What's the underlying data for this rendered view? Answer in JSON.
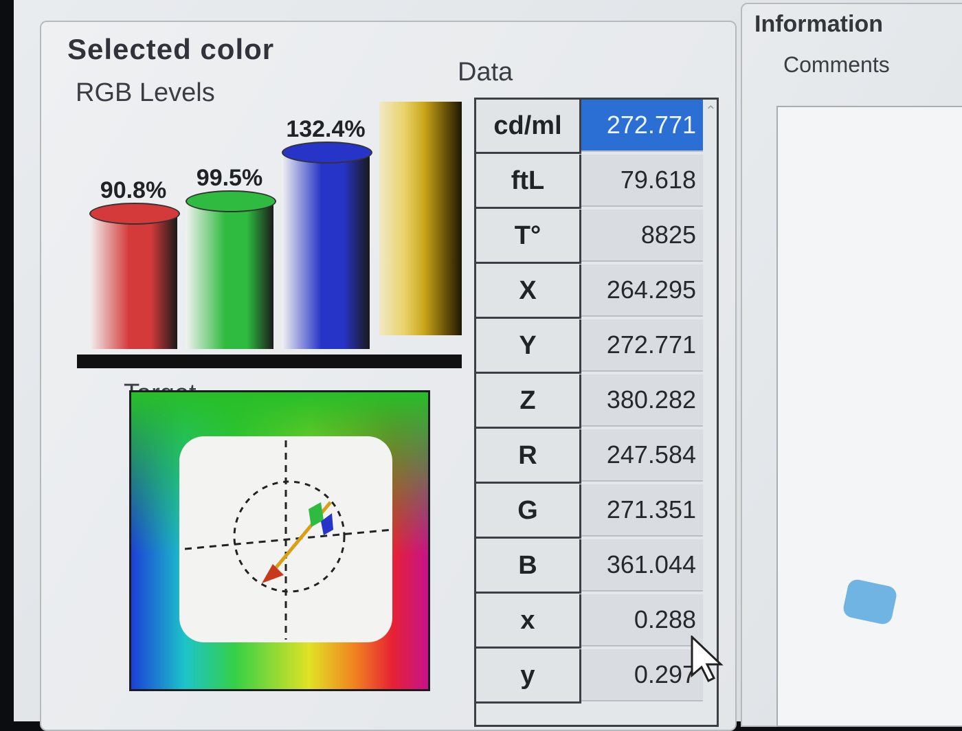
{
  "selected_color": {
    "title": "Selected color"
  },
  "rgb_levels": {
    "label": "RGB Levels",
    "bars": [
      {
        "name": "R",
        "label": "90.8%",
        "value": 90.8,
        "color": "#d43a3a"
      },
      {
        "name": "G",
        "label": "99.5%",
        "value": 99.5,
        "color": "#2fbb3f"
      },
      {
        "name": "B",
        "label": "132.4%",
        "value": 132.4,
        "color": "#2634c8"
      }
    ]
  },
  "target": {
    "label": "Target"
  },
  "data": {
    "label": "Data",
    "rows": [
      {
        "key": "cd/ml",
        "value": "272.771"
      },
      {
        "key": "ftL",
        "value": "79.618"
      },
      {
        "key": "T°",
        "value": "8825"
      },
      {
        "key": "X",
        "value": "264.295"
      },
      {
        "key": "Y",
        "value": "272.771"
      },
      {
        "key": "Z",
        "value": "380.282"
      },
      {
        "key": "R",
        "value": "247.584"
      },
      {
        "key": "G",
        "value": "271.351"
      },
      {
        "key": "B",
        "value": "361.044"
      },
      {
        "key": "x",
        "value": "0.288"
      },
      {
        "key": "y",
        "value": "0.297"
      }
    ]
  },
  "information": {
    "title": "Information",
    "comments_label": "Comments"
  },
  "icons": {
    "scroll": "chevron-up-icon",
    "cursor": "mouse-pointer-icon",
    "watermark": "logo-icon"
  }
}
